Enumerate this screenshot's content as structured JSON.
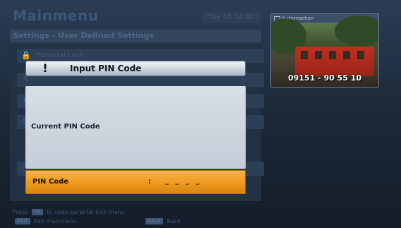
{
  "menu": {
    "title": "Mainmenu",
    "datetime": "Tue 05 14:30",
    "subheader": "Settings - User Defined Settings",
    "items": [
      {
        "label": "Parental Lock",
        "icon": "lock-icon"
      },
      {
        "label": "",
        "icon": "pen-icon"
      },
      {
        "label": "",
        "icon": "gear-icon"
      },
      {
        "label": "",
        "icon": "person-icon"
      },
      {
        "label": "",
        "icon": "info-icon"
      }
    ],
    "hint_prefix": "Press",
    "hint_key": "OK",
    "hint_text": "to open parental lock menu",
    "footer_exit_key": "EXIT",
    "footer_exit_label": "Exit mainmenu",
    "footer_back_key": "BACK",
    "footer_back_label": "Back"
  },
  "preview": {
    "channel_name": "tv-fernsehen",
    "phone_overlay": "09151 - 90 55 10"
  },
  "dialog": {
    "icon": "exclamation-icon",
    "icon_glyph": "!",
    "title": "Input PIN Code",
    "body_label": "Current PIN Code",
    "pin_label": "PIN Code",
    "pin_separator": ":",
    "pin_value": "_ _ _ _"
  },
  "colors": {
    "highlight": "#ee9a1e",
    "dialog_body": "#c4ced8",
    "background": "#1d2a3b"
  }
}
